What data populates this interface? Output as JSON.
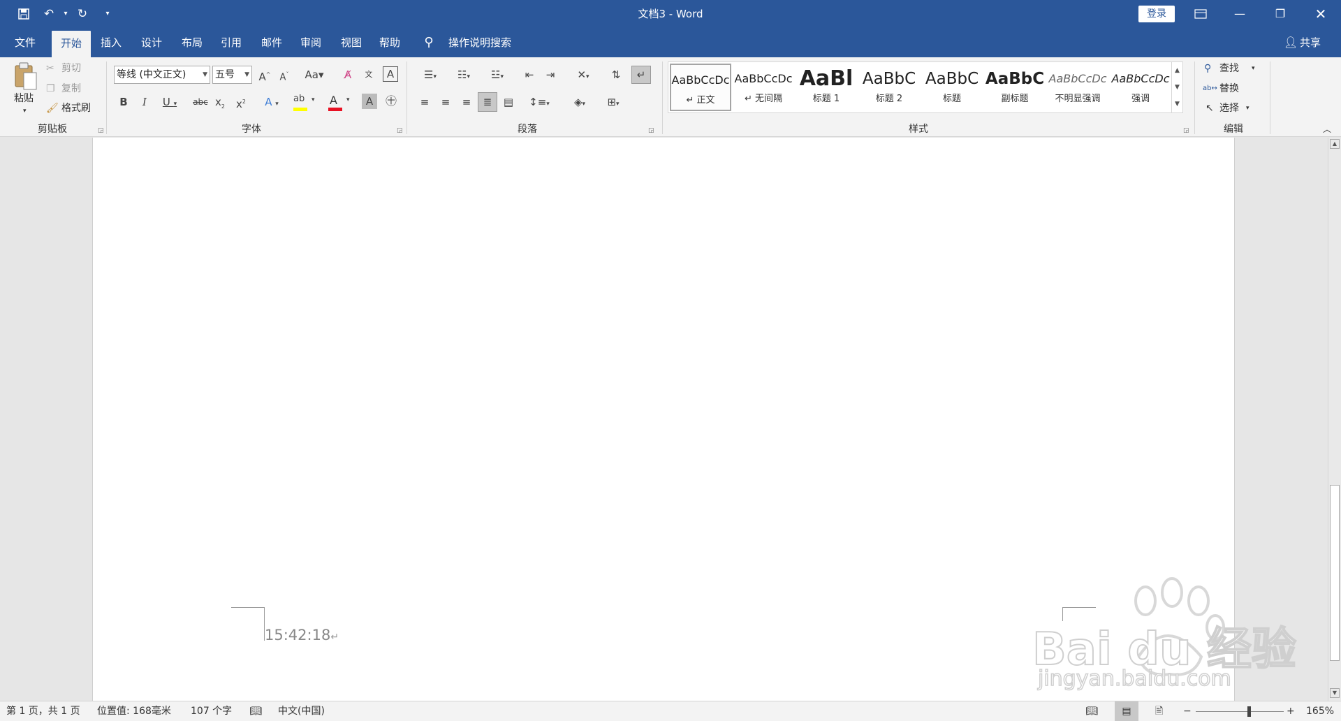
{
  "window": {
    "title": "文档3  -  Word",
    "login_label": "登录"
  },
  "tabs": [
    "文件",
    "开始",
    "插入",
    "设计",
    "布局",
    "引用",
    "邮件",
    "审阅",
    "视图",
    "帮助"
  ],
  "tell_me": "操作说明搜索",
  "share_label": "共享",
  "clipboard": {
    "paste": "粘贴",
    "cut": "剪切",
    "copy": "复制",
    "format_painter": "格式刷",
    "group_label": "剪贴板"
  },
  "font": {
    "font_name": "等线 (中文正文)",
    "font_size": "五号",
    "group_label": "字体",
    "colors": {
      "highlight": "#ffff00",
      "font_color": "#e81123"
    }
  },
  "paragraph": {
    "group_label": "段落"
  },
  "styles": {
    "group_label": "样式",
    "items": [
      {
        "preview": "AaBbCcDc",
        "label": "正文",
        "selected": true
      },
      {
        "preview": "AaBbCcDc",
        "label": "无间隔"
      },
      {
        "preview": "AaBl",
        "label": "标题 1"
      },
      {
        "preview": "AaBbC",
        "label": "标题 2"
      },
      {
        "preview": "AaBbC",
        "label": "标题"
      },
      {
        "preview": "AaBbC",
        "label": "副标题"
      },
      {
        "preview": "AaBbCcDc",
        "label": "不明显强调"
      },
      {
        "preview": "AaBbCcDc",
        "label": "强调"
      }
    ]
  },
  "editing": {
    "find": "查找",
    "replace": "替换",
    "select": "选择",
    "group_label": "编辑"
  },
  "document": {
    "footer_text": "15:42:18"
  },
  "statusbar": {
    "page": "第 1 页，共 1 页",
    "position": "位置值: 168毫米",
    "word_count": "107 个字",
    "language": "中文(中国)",
    "zoom": "165%",
    "zoom_level": 0.6
  },
  "watermark": {
    "brand": "Bai du 经验",
    "url": "jingyan.baidu.com"
  },
  "theme": {
    "accent": "#2b579a"
  }
}
